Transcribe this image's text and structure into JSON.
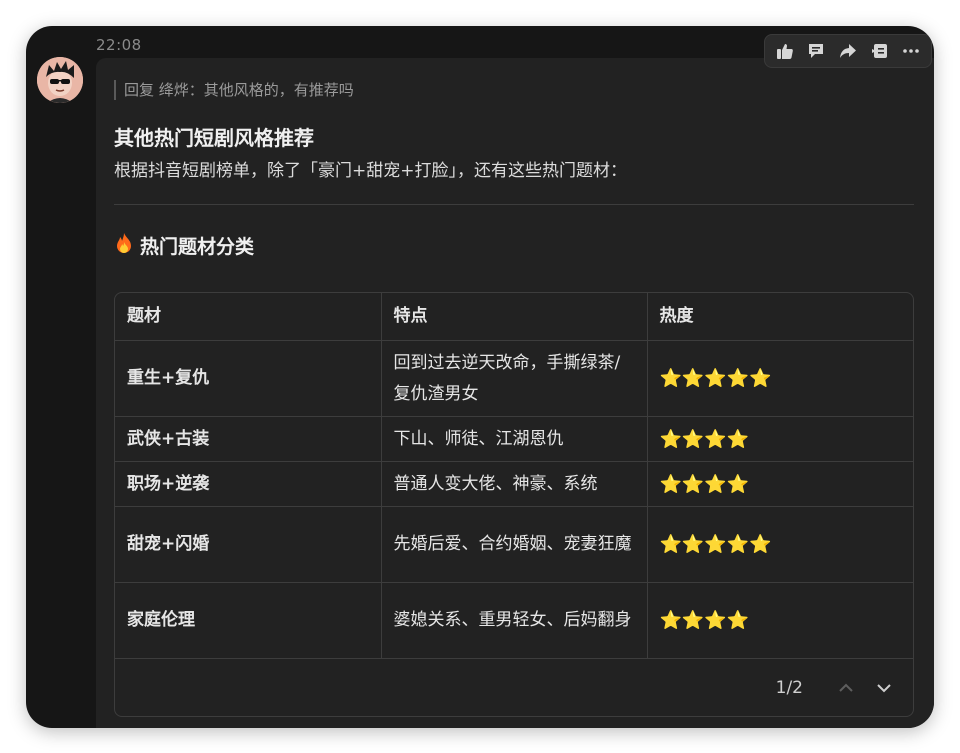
{
  "message": {
    "time": "22:08",
    "reply_quote": "回复 绛烨：其他风格的，有推荐吗",
    "title": "其他热门短剧风格推荐",
    "subtitle": "根据抖音短剧榜单，除了「豪门+甜宠+打脸」，还有这些热门题材：",
    "section_icon": "fire-emoji",
    "section_title": "热门题材分类"
  },
  "toolbar": {
    "icons": [
      "thumbs-up-icon",
      "comment-icon",
      "forward-icon",
      "reference-icon",
      "more-icon"
    ]
  },
  "table": {
    "headers": [
      "题材",
      "特点",
      "热度"
    ],
    "rows": [
      {
        "topic": "重生+复仇",
        "feature": "回到过去逆天改命，手撕绿茶/复仇渣男女",
        "heat": "⭐⭐⭐⭐⭐",
        "stars": 5
      },
      {
        "topic": "武侠+古装",
        "feature": "下山、师徒、江湖恩仇",
        "heat": "⭐⭐⭐⭐",
        "stars": 4
      },
      {
        "topic": "职场+逆袭",
        "feature": "普通人变大佬、神豪、系统",
        "heat": "⭐⭐⭐⭐",
        "stars": 4
      },
      {
        "topic": "甜宠+闪婚",
        "feature": "先婚后爱、合约婚姻、宠妻狂魔",
        "heat": "⭐⭐⭐⭐⭐",
        "stars": 5
      },
      {
        "topic": "家庭伦理",
        "feature": "婆媳关系、重男轻女、后妈翻身",
        "heat": "⭐⭐⭐⭐",
        "stars": 4
      }
    ],
    "pagination": "1/2"
  },
  "colors": {
    "window_bg": "#161616",
    "bubble_bg": "#222222",
    "star": "#f5c21b",
    "text": "#e6e6e6"
  }
}
